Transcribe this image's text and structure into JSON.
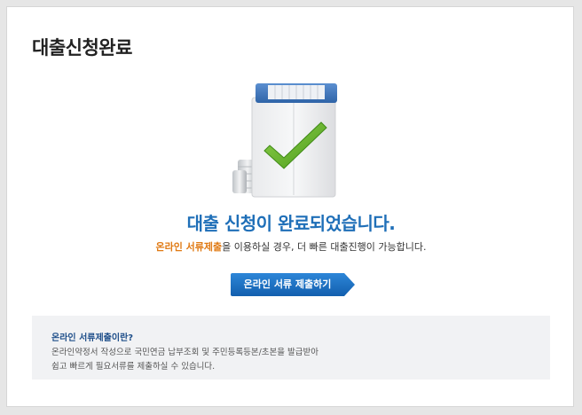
{
  "page": {
    "title": "대출신청완료"
  },
  "result": {
    "headline": "대출 신청이 완료되었습니다.",
    "sub_highlight": "온라인 서류제출",
    "sub_rest": "을 이용하실 경우, 더 빠른 대출진행이 가능합니다.",
    "icon": "clipboard-checkmark-icon"
  },
  "actions": {
    "submit_docs_label": "온라인 서류 제출하기"
  },
  "info": {
    "title": "온라인 서류제출이란?",
    "line1": "온라인약정서 작성으로 국민연금 납부조회 및 주민등록등본/초본을 발급받아",
    "line2": "쉽고 빠르게 필요서류를 제출하실 수 있습니다."
  },
  "colors": {
    "headline": "#1f6fb8",
    "highlight": "#e07a14",
    "button": "#1a6fc4",
    "checkmark": "#6ab52a"
  }
}
